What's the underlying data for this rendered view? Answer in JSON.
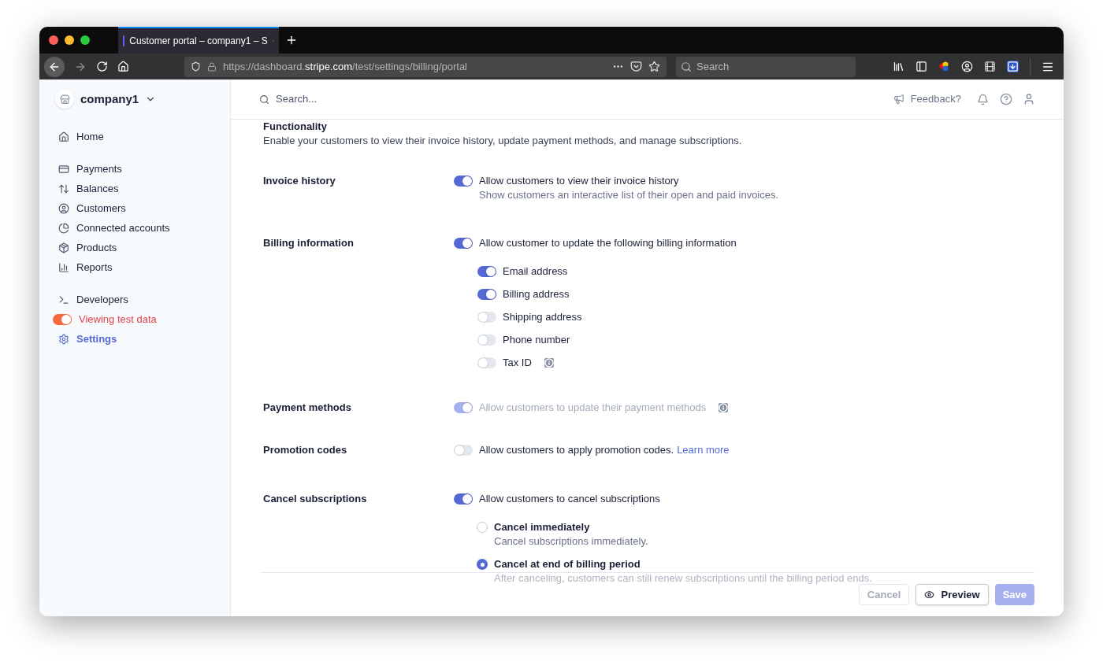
{
  "browser": {
    "tab_title": "Customer portal – company1 – S",
    "url": {
      "prefix": "https://dashboard.",
      "domain": "stripe.com",
      "path": "/test/settings/billing/portal"
    },
    "search": {
      "placeholder": "Search"
    }
  },
  "sidebar": {
    "account": "company1",
    "groups": [
      [
        {
          "kind": "link",
          "label": "Home",
          "selected": false
        }
      ],
      [
        {
          "kind": "link",
          "label": "Payments",
          "selected": false
        },
        {
          "kind": "link",
          "label": "Balances",
          "selected": false
        },
        {
          "kind": "link",
          "label": "Customers",
          "selected": false
        },
        {
          "kind": "link",
          "label": "Connected accounts",
          "selected": false
        },
        {
          "kind": "link",
          "label": "Products",
          "selected": false
        },
        {
          "kind": "link",
          "label": "Reports",
          "selected": false
        }
      ],
      [
        {
          "kind": "link",
          "label": "Developers",
          "selected": false
        },
        {
          "kind": "toggle",
          "label": "Viewing test data",
          "on": true,
          "selected": false
        },
        {
          "kind": "link",
          "label": "Settings",
          "selected": true
        }
      ]
    ]
  },
  "header": {
    "search": {
      "placeholder": "Search..."
    },
    "feedback": "Feedback?"
  },
  "functionality": {
    "title": "Functionality",
    "description": "Enable your customers to view their invoice history, update payment methods, and manage subscriptions."
  },
  "sections": [
    {
      "label": "Invoice history",
      "toggle": {
        "on": true,
        "disabled": false,
        "text": "Allow customers to view their invoice history",
        "hint": "Show customers an interactive list of their open and paid invoices.",
        "info": false
      }
    },
    {
      "label": "Billing information",
      "toggle": {
        "on": true,
        "disabled": false,
        "text": "Allow customer to update the following billing information",
        "info": false
      },
      "options": [
        {
          "kind": "toggle",
          "label": "Email address",
          "on": true,
          "info": false
        },
        {
          "kind": "toggle",
          "label": "Billing address",
          "on": true,
          "info": false
        },
        {
          "kind": "toggle",
          "label": "Shipping address",
          "on": false,
          "info": false
        },
        {
          "kind": "toggle",
          "label": "Phone number",
          "on": false,
          "info": false
        },
        {
          "kind": "toggle",
          "label": "Tax ID",
          "on": false,
          "info": true
        }
      ]
    },
    {
      "label": "Payment methods",
      "toggle": {
        "on": true,
        "disabled": true,
        "text": "Allow customers to update their payment methods",
        "info": true
      }
    },
    {
      "label": "Promotion codes",
      "toggle": {
        "on": false,
        "disabled": false,
        "text": "Allow customers to apply promotion codes.",
        "link": "Learn more",
        "info": false
      }
    },
    {
      "label": "Cancel subscriptions",
      "toggle": {
        "on": true,
        "disabled": false,
        "text": "Allow customers to cancel subscriptions",
        "info": false
      },
      "options": [
        {
          "kind": "radio",
          "label": "Cancel immediately",
          "description": "Cancel subscriptions immediately.",
          "selected": false,
          "faded": false
        },
        {
          "kind": "radio",
          "label": "Cancel at end of billing period",
          "description": "After canceling, customers can still renew subscriptions until the billing period ends.",
          "selected": true,
          "faded": true
        }
      ]
    }
  ],
  "footer": {
    "buttons": [
      {
        "kind": "secondary",
        "label": "Cancel",
        "disabled": true,
        "icon": false
      },
      {
        "kind": "secondary",
        "label": "Preview",
        "disabled": false,
        "icon": true
      },
      {
        "kind": "primary",
        "label": "Save",
        "disabled": true,
        "icon": false
      }
    ]
  }
}
